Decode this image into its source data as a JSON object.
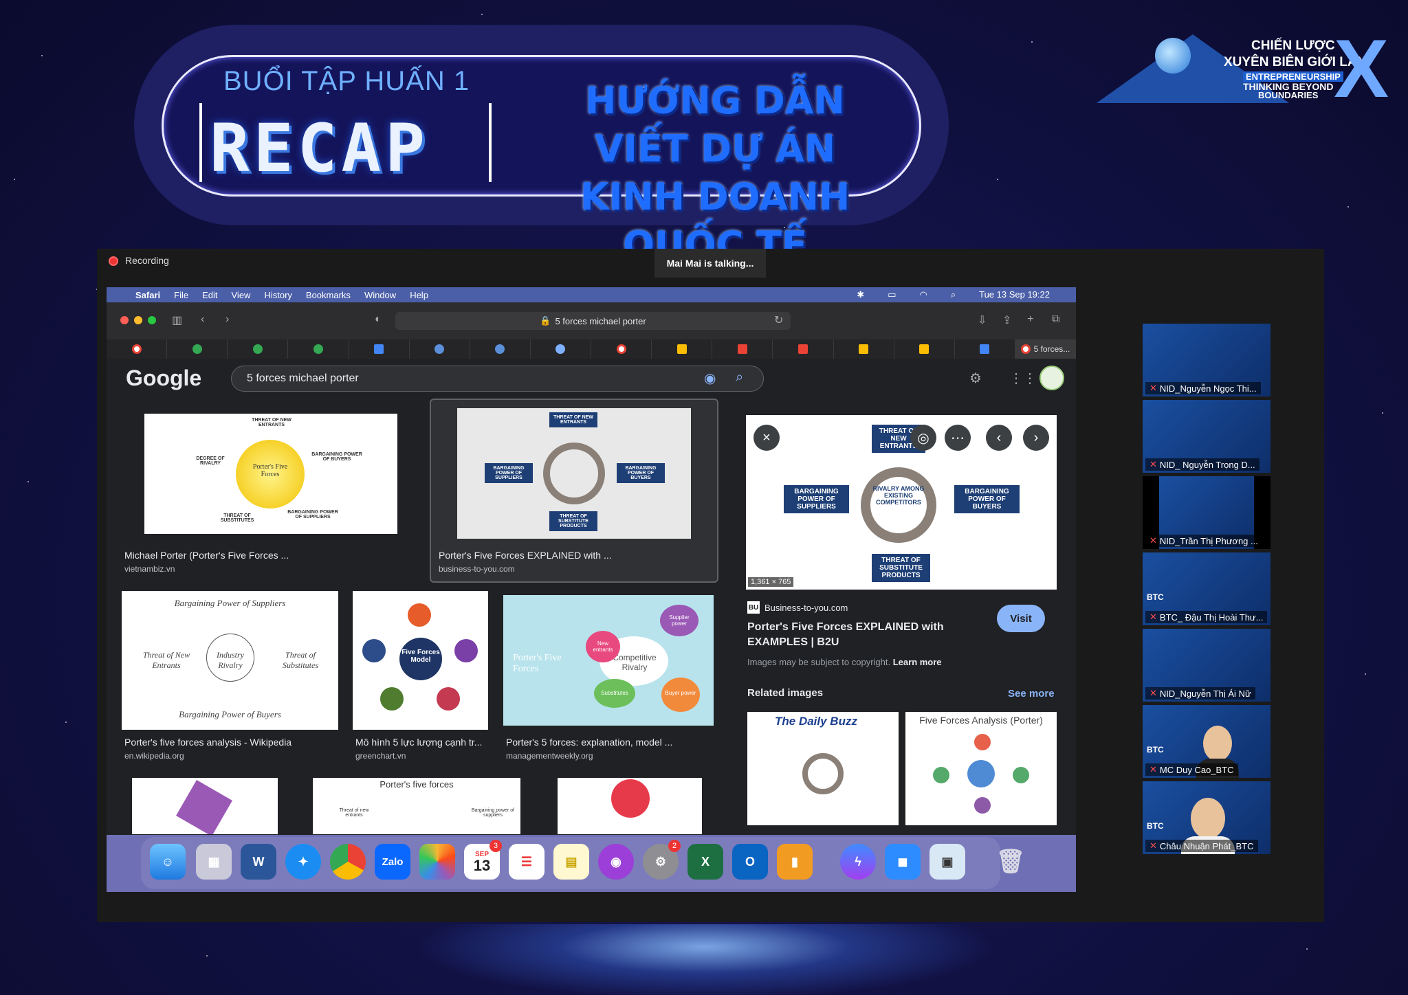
{
  "banner": {
    "session": "BUỔI TẬP HUẤN 1",
    "recap": "RECAP",
    "headline_line1": "HƯỚNG DẪN VIẾT DỰ ÁN",
    "headline_line2": "KINH DOANH QUỐC TẾ"
  },
  "logo": {
    "line1": "CHIẾN LƯỢC",
    "line2": "XUYÊN BIÊN GIỚI LẦN",
    "line3": "ENTREPRENEURSHIP",
    "line4": "THINKING BEYOND",
    "line5": "BOUNDARIES",
    "mark": "X"
  },
  "zoom": {
    "recording": "Recording",
    "talking": "Mai Mai is talking..."
  },
  "mac": {
    "menu": [
      "Safari",
      "File",
      "Edit",
      "View",
      "History",
      "Bookmarks",
      "Window",
      "Help"
    ],
    "clock": "Tue 13 Sep  19:22"
  },
  "safari": {
    "address": "5 forces michael porter",
    "active_tab": "5 forces..."
  },
  "google": {
    "logo": "Google",
    "query": "5 forces michael porter"
  },
  "results": [
    {
      "caption": "Michael Porter (Porter's Five Forces ...",
      "source": "vietnambiz.vn"
    },
    {
      "caption": "Porter's Five Forces EXPLAINED with ...",
      "source": "business-to-you.com"
    },
    {
      "caption": "Porter's five forces analysis - Wikipedia",
      "source": "en.wikipedia.org"
    },
    {
      "caption": "Mô hình 5 lực lượng cạnh tr...",
      "source": "greenchart.vn"
    },
    {
      "caption": "Porter's 5 forces: explanation, model ...",
      "source": "managementweekly.org"
    }
  ],
  "thumbs": {
    "t1_center": "Porter's Five Forces",
    "t1_top": "THREAT OF NEW ENTRANTS",
    "t1_left": "DEGREE OF RIVALRY",
    "t1_right": "BARGAINING POWER OF BUYERS",
    "t1_bl": "THREAT OF SUBSTITUTES",
    "t1_br": "BARGAINING POWER OF SUPPLIERS",
    "t3_top": "Bargaining Power of Suppliers",
    "t3_left": "Threat of New Entrants",
    "t3_center": "Industry Rivalry",
    "t3_right": "Threat of Substitutes",
    "t3_bottom": "Bargaining Power of Buyers",
    "t4_center": "Five Forces Model",
    "t5_left": "Porter's Five Forces",
    "t5_center": "Competitive Rivalry",
    "t5_new": "New entrants",
    "t5_sup": "Supplier power",
    "t5_sub": "Substitutes",
    "t5_buy": "Buyer power",
    "t7_title": "Porter's five forces",
    "t7_left": "Threat of new entrants",
    "t7_right": "Bargaining power of suppliers"
  },
  "panel": {
    "rivalry": "RIVALRY AMONG EXISTING COMPETITORS",
    "new_entrants": "THREAT OF NEW ENTRANTS",
    "suppliers": "BARGAINING POWER OF SUPPLIERS",
    "buyers": "BARGAINING POWER OF BUYERS",
    "substitutes": "THREAT OF SUBSTITUTE PRODUCTS",
    "dims": "1,361 × 765",
    "source_badge": "BU",
    "source": "Business-to-you.com",
    "title": "Porter's Five Forces EXPLAINED with EXAMPLES | B2U",
    "copyright": "Images may be subject to copyright.",
    "learn_more": "Learn more",
    "visit": "Visit",
    "related": "Related images",
    "see_more": "See more",
    "related1": "The Daily Buzz",
    "related2": "Five Forces Analysis (Porter)"
  },
  "dock": {
    "calendar_month": "SEP",
    "calendar_day": "13",
    "zalo": "Zalo",
    "badge_calendar": "3",
    "badge_settings": "2"
  },
  "participants": [
    {
      "name": "NID_Nguyễn Ngọc Thi...",
      "btc": ""
    },
    {
      "name": "NID_ Nguyễn Trọng D...",
      "btc": ""
    },
    {
      "name": "NID_Trần Thị Phương ...",
      "btc": ""
    },
    {
      "name": "BTC_ Đậu Thị Hoài Thư...",
      "btc": "BTC"
    },
    {
      "name": "NID_Nguyễn Thị Ái Nữ",
      "btc": ""
    },
    {
      "name": "MC Duy Cao_BTC",
      "btc": "BTC"
    },
    {
      "name": "Châu Nhuận Phát_BTC",
      "btc": "BTC"
    }
  ],
  "colors": {
    "accent_blue": "#1f6dff",
    "visit": "#8ab4f8",
    "mic_off": "#ff4d4d"
  }
}
